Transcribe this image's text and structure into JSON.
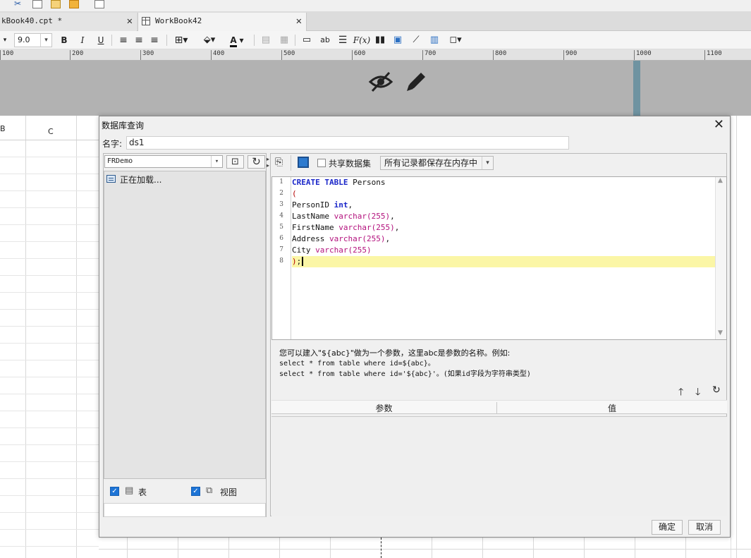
{
  "tabs": [
    {
      "label": "kBook40.cpt *",
      "close": "✕"
    },
    {
      "label": "WorkBook42",
      "close": "✕"
    }
  ],
  "toolbar": {
    "font_size": "9.0",
    "bold": "B",
    "italic": "I",
    "underline": "U",
    "text_label": "ab",
    "formula_label": "F(x)"
  },
  "ruler": {
    "ticks": [
      "100",
      "200",
      "300",
      "400",
      "500",
      "600",
      "700",
      "800",
      "900",
      "1000",
      "1100"
    ]
  },
  "sheet": {
    "col_b": "B",
    "col_c": "C"
  },
  "dialog": {
    "title": "数据库查询",
    "close": "✕",
    "name_label": "名字:",
    "name_value": "ds1",
    "database": "FRDemo",
    "tree_loading": "正在加载...",
    "table_label": "表",
    "view_label": "视图",
    "share_label": "共享数据集",
    "memory_option": "所有记录都保存在内存中",
    "code_lines": [
      "CREATE TABLE Persons",
      "(",
      "PersonID int,",
      "LastName varchar(255),",
      "FirstName varchar(255),",
      "Address varchar(255),",
      "City varchar(255)",
      ");"
    ],
    "hint": {
      "line1": "您可以建入\"${abc}\"做为一个参数，这里abc是参数的名称。例如:",
      "line2": "select * from table where id=${abc}。",
      "line3": "select * from table where id='${abc}'。(如果id字段为字符串类型)"
    },
    "param_col": "参数",
    "value_col": "值",
    "ok_label": "确定",
    "cancel_label": "取消"
  }
}
